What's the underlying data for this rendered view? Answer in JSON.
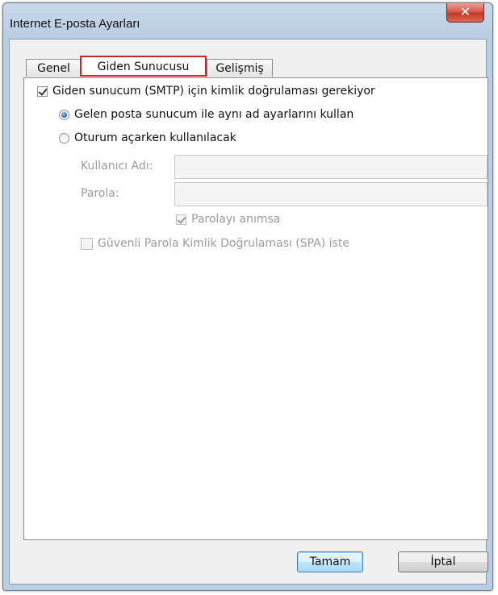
{
  "window": {
    "title": "Internet E-posta Ayarları",
    "close_label": "✕"
  },
  "tabs": [
    {
      "label": "Genel",
      "active": false
    },
    {
      "label": "Giden Sunucusu",
      "active": true
    },
    {
      "label": "Gelişmiş",
      "active": false
    }
  ],
  "outgoing": {
    "smtp_auth": {
      "label": "Giden sunucum (SMTP) için kimlik doğrulaması gerekiyor",
      "checked": true
    },
    "use_same_settings": {
      "label": "Gelen posta sunucum ile aynı ad ayarlarını kullan",
      "selected": true
    },
    "log_on_using": {
      "label": "Oturum açarken kullanılacak",
      "selected": false
    },
    "username": {
      "label": "Kullanıcı Adı:",
      "value": ""
    },
    "password": {
      "label": "Parola:",
      "value": ""
    },
    "remember_password": {
      "label": "Parolayı anımsa",
      "checked": true,
      "enabled": false
    },
    "spa": {
      "label": "Güvenli Parola Kimlik Doğrulaması (SPA) iste",
      "checked": false,
      "enabled": false
    }
  },
  "buttons": {
    "ok": "Tamam",
    "cancel": "İptal"
  },
  "colors": {
    "highlight_border": "#c8262b",
    "radio_fill": "#1c5fa8"
  }
}
